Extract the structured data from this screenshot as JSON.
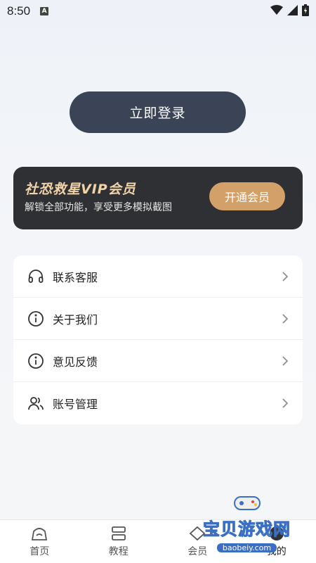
{
  "status_bar": {
    "time": "8:50",
    "notification_icon": "A"
  },
  "login": {
    "label": "立即登录"
  },
  "vip": {
    "title": "社恐救星VIP会员",
    "subtitle": "解锁全部功能，享受更多模拟截图",
    "button": "开通会员",
    "accent": "#d4a06a"
  },
  "menu": {
    "items": [
      {
        "label": "联系客服",
        "icon": "headset-icon"
      },
      {
        "label": "关于我们",
        "icon": "info-icon"
      },
      {
        "label": "意见反馈",
        "icon": "info-icon"
      },
      {
        "label": "账号管理",
        "icon": "users-icon"
      }
    ]
  },
  "tabbar": {
    "tabs": [
      {
        "label": "首页",
        "icon": "home-icon"
      },
      {
        "label": "教程",
        "icon": "tutorial-icon"
      },
      {
        "label": "会员",
        "icon": "vip-icon"
      },
      {
        "label": "我的",
        "icon": "profile-icon"
      }
    ]
  },
  "watermark": {
    "text": "宝贝游戏网",
    "url": "baobeiy.com"
  }
}
